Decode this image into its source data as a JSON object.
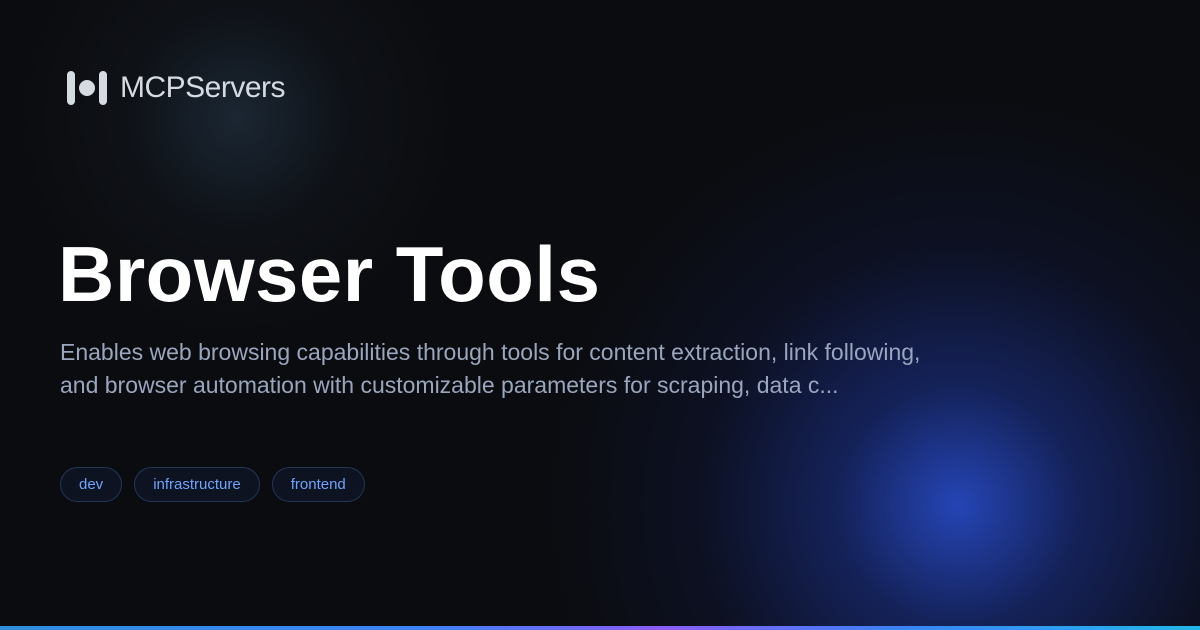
{
  "brand": {
    "name": "MCPServers",
    "logo_icon": "mcp-logo-icon"
  },
  "server": {
    "title": "Browser Tools",
    "description": "Enables web browsing capabilities through tools for content extraction, link following, and browser automation with customizable parameters for scraping, data c...",
    "tags": [
      "dev",
      "infrastructure",
      "frontend"
    ]
  },
  "colors": {
    "background": "#0b0c0f",
    "title": "#ffffff",
    "description": "#9aa6bd",
    "tag_text": "#6ea4ff",
    "tag_border": "#24365a",
    "glow": "#2648be"
  }
}
